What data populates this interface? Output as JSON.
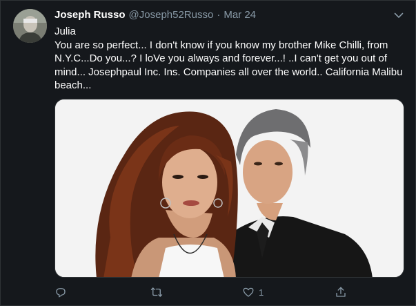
{
  "tweet": {
    "author_name": "Joseph Russo",
    "handle": "@Joseph52Russo",
    "separator": "·",
    "date": "Mar 24",
    "text_line1": "Julia",
    "text_line2": "You are so perfect... I don't know if you know my brother Mike Chilli, from N.Y.C...Do you...? I loVe you always and forever...! ..I can't get you out of mind... Josephpaul Inc. Ins. Companies all over the world.. California Malibu beach..."
  },
  "actions": {
    "reply_icon": "reply-icon",
    "retweet_icon": "retweet-icon",
    "like_icon": "heart-icon",
    "like_count": "1",
    "share_icon": "share-icon"
  },
  "colors": {
    "background": "#15181c",
    "secondary_text": "#8899a6",
    "primary_text": "#ffffff",
    "border": "#2f3336"
  }
}
